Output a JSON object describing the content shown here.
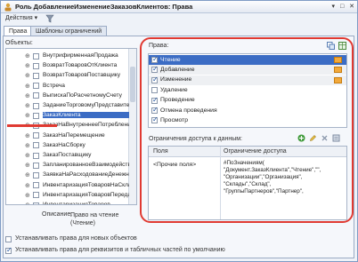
{
  "window": {
    "title": "Роль ДобавлениеИзменениеЗаказовКлиентов: Права",
    "controls": [
      "▾",
      "□",
      "✕"
    ]
  },
  "toolbar": {
    "actions_label": "Действия ▾"
  },
  "tabs": [
    {
      "label": "Права",
      "active": true
    },
    {
      "label": "Шаблоны ограничений",
      "active": false
    }
  ],
  "objects": {
    "label": "Объекты:",
    "items": [
      {
        "label": "ВнутрифирменнаяПродажа",
        "selected": false
      },
      {
        "label": "ВозвратТоваровОтКлиента",
        "selected": false
      },
      {
        "label": "ВозвратТоваровПоставщику",
        "selected": false
      },
      {
        "label": "Встреча",
        "selected": false
      },
      {
        "label": "ВыпискаПоРасчетномуСчету",
        "selected": false
      },
      {
        "label": "ЗаданиеТорговомуПредставителю",
        "selected": false
      },
      {
        "label": "ЗаказКлиента",
        "selected": true
      },
      {
        "label": "ЗаказНаВнутреннееПотребление",
        "selected": false
      },
      {
        "label": "ЗаказНаПеремещение",
        "selected": false
      },
      {
        "label": "ЗаказНаСборку",
        "selected": false
      },
      {
        "label": "ЗаказПоставщику",
        "selected": false
      },
      {
        "label": "ЗапланированноеВзаимодействие",
        "selected": false
      },
      {
        "label": "ЗаявкаНаРасходованиеДенежныхСредств",
        "selected": false
      },
      {
        "label": "ИнвентаризацияТоваровНаСкладе",
        "selected": false
      },
      {
        "label": "ИнвентаризацияТоваровПереданныхНаХранение",
        "selected": false
      },
      {
        "label": "ИнвентаризацияТоваров",
        "selected": false
      }
    ]
  },
  "description": {
    "label": "Описание:",
    "line1": "Право на чтение",
    "line2": "(Чтение)"
  },
  "options": [
    {
      "label": "Устанавливать права для новых объектов",
      "checked": false
    },
    {
      "label": "Устанавливать права для реквизитов и табличных частей по умолчанию",
      "checked": true
    }
  ],
  "rights": {
    "label": "Права:",
    "items": [
      {
        "label": "Чтение",
        "checked": true,
        "selected": true,
        "flag": true
      },
      {
        "label": "Добавление",
        "checked": true,
        "selected": false,
        "flag": true
      },
      {
        "label": "Изменение",
        "checked": true,
        "selected": false,
        "flag": true
      },
      {
        "label": "Удаление",
        "checked": false,
        "selected": false,
        "flag": false
      },
      {
        "label": "Проведение",
        "checked": true,
        "selected": false,
        "flag": false
      },
      {
        "label": "Отмена проведения",
        "checked": true,
        "selected": false,
        "flag": false
      },
      {
        "label": "Просмотр",
        "checked": true,
        "selected": false,
        "flag": false
      }
    ]
  },
  "restrictions": {
    "label": "Ограничения доступа к данным:",
    "columns": [
      "Поля",
      "Ограничение доступа"
    ],
    "row": {
      "fields": "<Прочие поля>",
      "condition_lines": [
        "#ПоЗначениям(",
        "\"Документ.ЗаказКлиента\",\"Чтение\",\"\",",
        "\"Организации\",\"Организация\",",
        "\"Склады\",\"Склад\",",
        "\"ГруппыПартнеров\",\"Партнер\","
      ]
    }
  },
  "colors": {
    "selection": "#3b6cc4",
    "highlight_annotation": "#e03a32",
    "flag": "#f2a93b"
  }
}
